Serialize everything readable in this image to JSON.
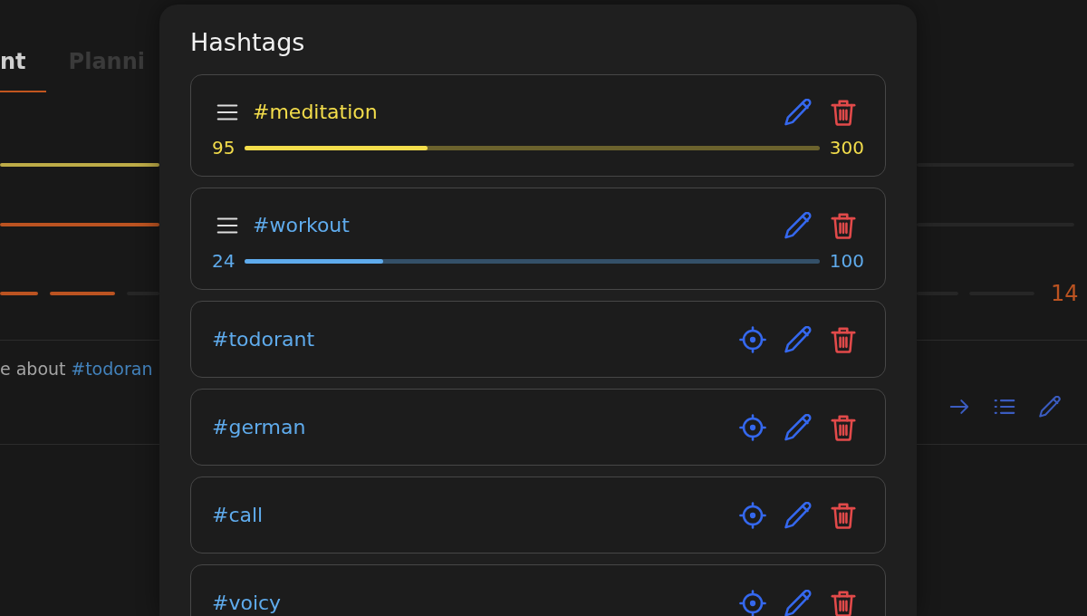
{
  "background": {
    "tabs": [
      {
        "label": "nt",
        "selected": true
      },
      {
        "label": "Planni",
        "selected": false
      }
    ],
    "bars": [
      {
        "kind": "solid",
        "color": "#bdab47"
      },
      {
        "kind": "solid",
        "color": "#bb5321"
      },
      {
        "kind": "segmented",
        "color": "#bb5321",
        "reading": "14"
      }
    ],
    "note": {
      "text": "e about",
      "hashtag": "#todoran"
    }
  },
  "dialog": {
    "title": "Hashtags",
    "items": [
      {
        "kind": "goal",
        "name": "#meditation",
        "color": "#f3dd4b",
        "current": "95",
        "goal": "300",
        "level": 0.317
      },
      {
        "kind": "goal",
        "name": "#workout",
        "color": "#5fabec",
        "current": "24",
        "goal": "100",
        "level": 0.24
      },
      {
        "kind": "plain",
        "name": "#todorant",
        "color": "#5fabec"
      },
      {
        "kind": "plain",
        "name": "#german",
        "color": "#5fabec"
      },
      {
        "kind": "plain",
        "name": "#call",
        "color": "#5fabec"
      },
      {
        "kind": "plain",
        "name": "#voicy",
        "color": "#5fabec"
      }
    ]
  }
}
